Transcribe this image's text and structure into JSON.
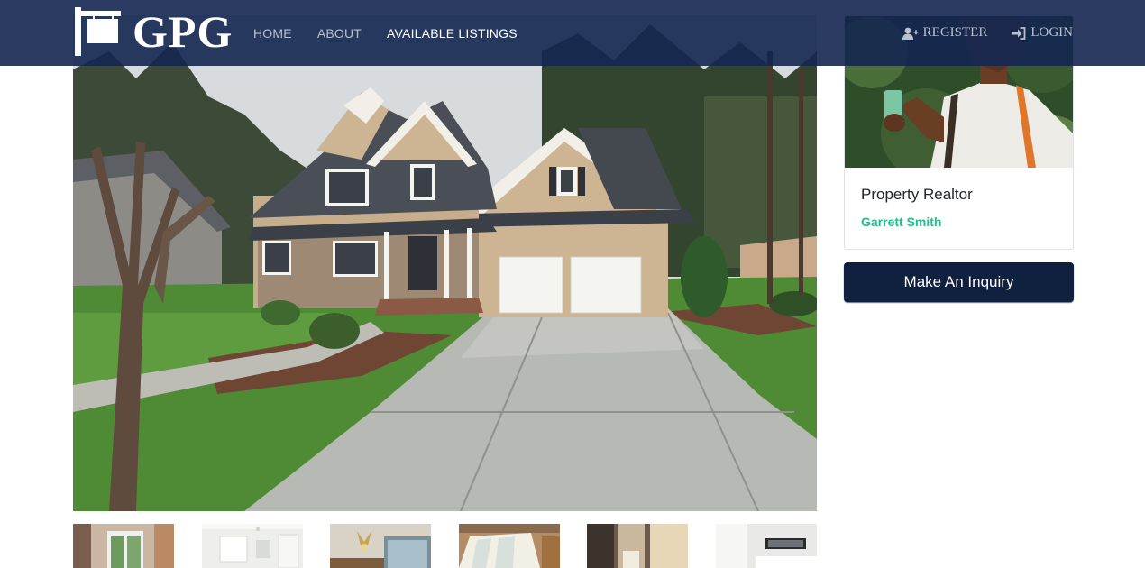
{
  "brand": {
    "name": "GPG"
  },
  "nav": {
    "links": [
      {
        "label": "HOME"
      },
      {
        "label": "ABOUT"
      },
      {
        "label": "AVAILABLE LISTINGS"
      }
    ],
    "register_label": "REGISTER",
    "login_label": "LOGIN"
  },
  "realtor": {
    "title": "Property Realtor",
    "name": "Garrett Smith"
  },
  "inquiry_button": "Make An Inquiry",
  "icons": {
    "register": "user-plus-icon",
    "login": "sign-in-icon"
  },
  "colors": {
    "navbar": "#142650",
    "accent": "#1fbf8f",
    "button": "#10203f"
  }
}
